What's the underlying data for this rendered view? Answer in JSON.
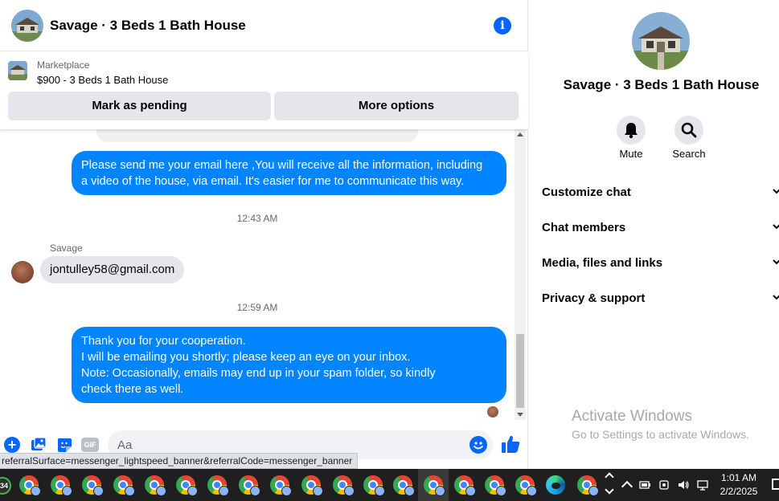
{
  "chat": {
    "title": "Savage · 3 Beds 1 Bath House",
    "listing": {
      "category": "Marketplace",
      "price_title": "$900 - 3 Beds 1 Bath House",
      "primary_action": "Mark as pending",
      "secondary_action": "More options"
    },
    "messages": {
      "m1": {
        "direction": "outgoing",
        "lines": [
          "Please send me your email here ,You will receive all the information, including",
          "a video of the house, via email. It's easier for me to communicate this way."
        ]
      },
      "ts1": "12:43 AM",
      "sender": "Savage",
      "m2": {
        "direction": "incoming",
        "text": "jontulley58@gmail.com"
      },
      "ts2": "12:59 AM",
      "m3": {
        "direction": "outgoing",
        "lines": [
          "Thank you for your cooperation.",
          "I will be emailing you shortly; please keep an eye on your inbox.",
          "Note: Occasionally, emails may end up in your spam folder, so kindly",
          "check there as well."
        ]
      }
    },
    "composer": {
      "placeholder": "Aa",
      "gif_label": "GIF"
    },
    "status_url": "referralSurface=messenger_lightspeed_banner&referralCode=messenger_banner"
  },
  "info_pane": {
    "title": "Savage · 3 Beds 1 Bath House",
    "actions": {
      "mute": "Mute",
      "search": "Search"
    },
    "sections": {
      "s1": "Customize chat",
      "s2": "Chat members",
      "s3": "Media, files and links",
      "s4": "Privacy & support"
    }
  },
  "watermark": {
    "title": "Activate Windows",
    "subtitle": "Go to Settings to activate Windows."
  },
  "taskbar": {
    "badge": "34",
    "time": "1:01 AM",
    "date": "2/2/2025"
  },
  "colors": {
    "accent": "#0866ff",
    "outgoing_bubble": "#0084ff",
    "incoming_bubble": "#e4e6eb",
    "taskbar": "#1f1f1f"
  },
  "icons": [
    "info-icon",
    "bell-icon",
    "search-icon",
    "chevron-down-icon",
    "plus-icon",
    "photo-icon",
    "sticker-icon",
    "gif-icon",
    "emoji-icon",
    "like-icon",
    "chrome-icon",
    "edge-icon"
  ]
}
